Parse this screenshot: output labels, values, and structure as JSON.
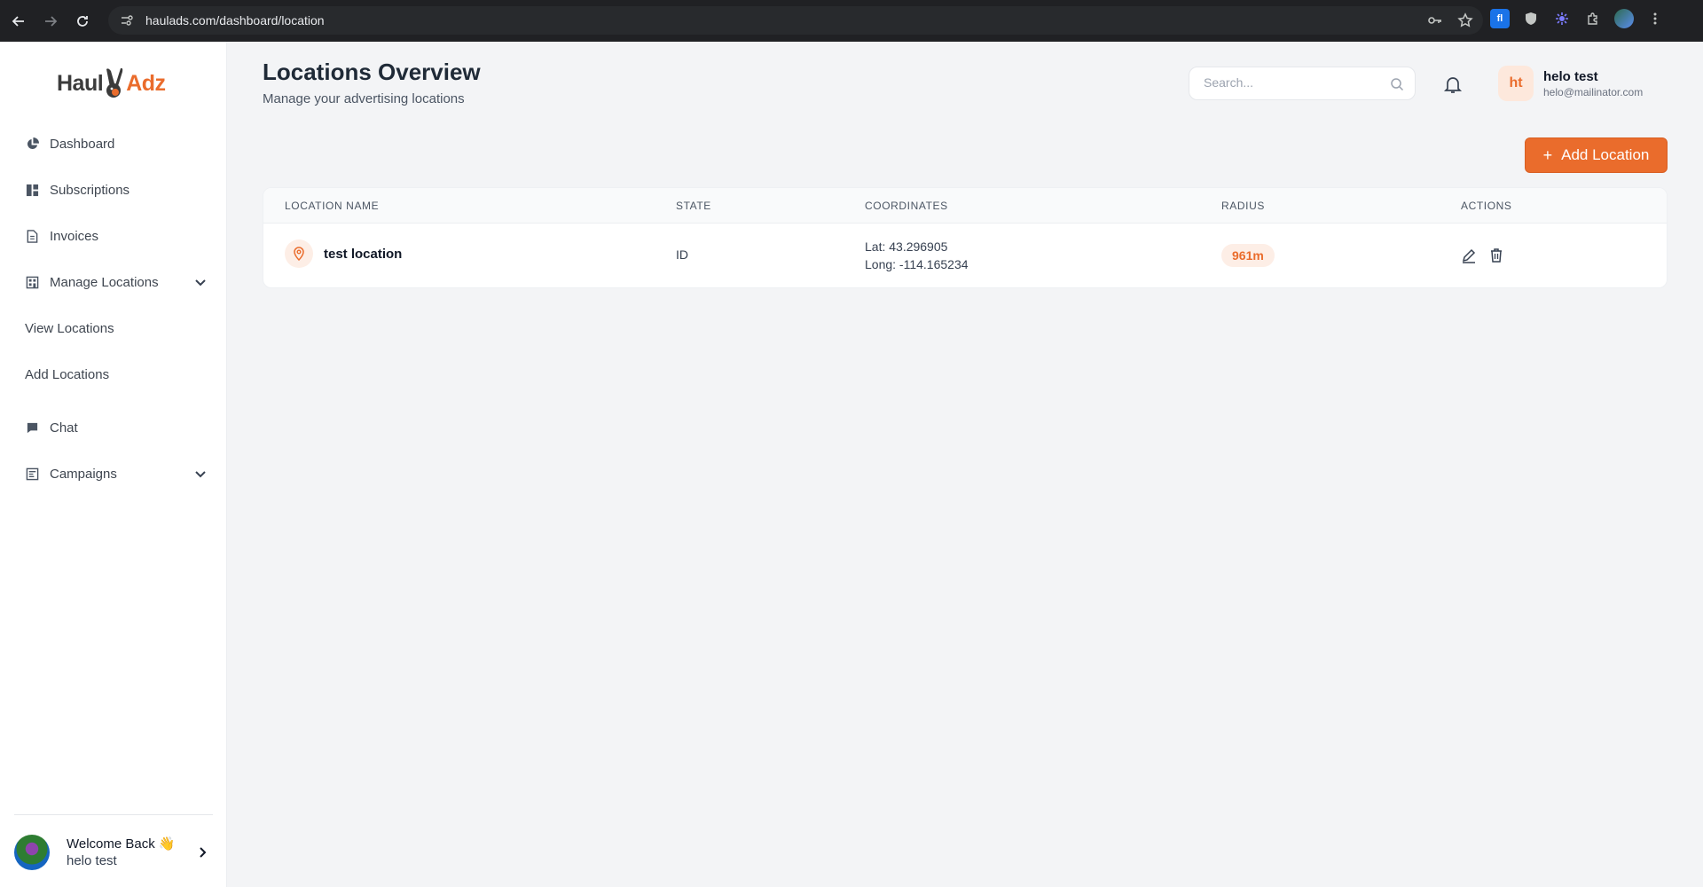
{
  "browser": {
    "url": "haulads.com/dashboard/location"
  },
  "brand": {
    "part1": "Haul",
    "part2": "Adz",
    "accent": "#ea6c2c"
  },
  "sidebar": {
    "items": [
      {
        "label": "Dashboard",
        "icon": "pie-chart-icon"
      },
      {
        "label": "Subscriptions",
        "icon": "grid-icon"
      },
      {
        "label": "Invoices",
        "icon": "document-icon"
      },
      {
        "label": "Manage Locations",
        "icon": "building-icon"
      },
      {
        "label": "View Locations"
      },
      {
        "label": "Add Locations"
      },
      {
        "label": "Chat",
        "icon": "chat-icon"
      },
      {
        "label": "Campaigns",
        "icon": "campaign-icon"
      }
    ],
    "footer": {
      "welcome": "Welcome Back 👋",
      "name": "helo test"
    }
  },
  "header": {
    "title": "Locations Overview",
    "subtitle": "Manage your advertising locations",
    "search_placeholder": "Search...",
    "user_initials": "ht",
    "user_name": "helo test",
    "user_email": "helo@mailinator.com"
  },
  "toolbar": {
    "add_label": "Add Location"
  },
  "table": {
    "columns": [
      "LOCATION NAME",
      "STATE",
      "COORDINATES",
      "RADIUS",
      "ACTIONS"
    ],
    "rows": [
      {
        "name": "test location",
        "state": "ID",
        "lat": "Lat: 43.296905",
        "long": "Long: -114.165234",
        "radius": "961m"
      }
    ]
  }
}
